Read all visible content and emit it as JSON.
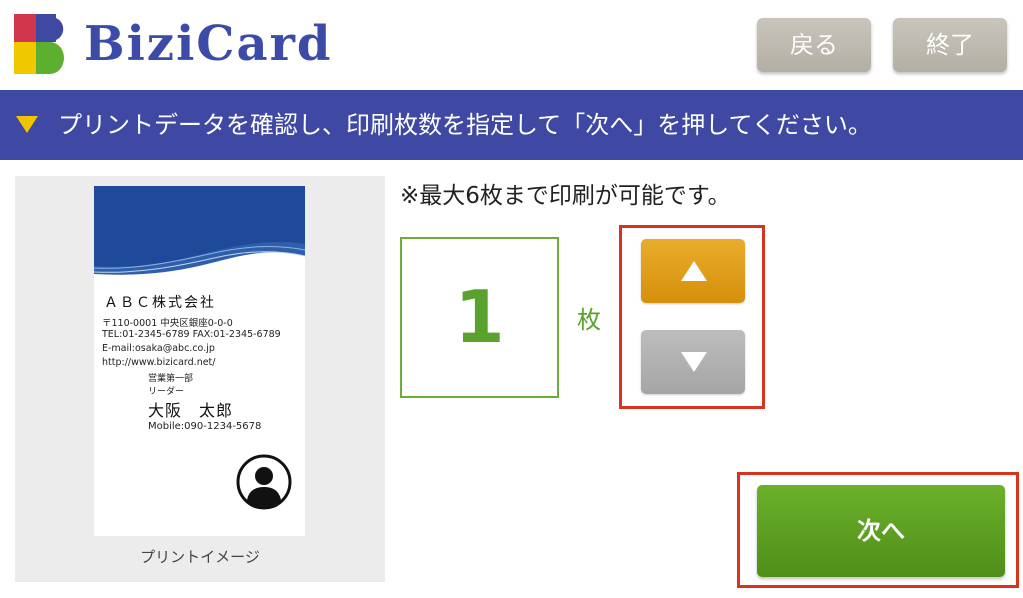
{
  "header": {
    "logo_text": "BiziCard",
    "back_label": "戻る",
    "exit_label": "終了"
  },
  "instruction": {
    "text": "プリントデータを確認し、印刷枚数を指定して「次へ」を押してください。"
  },
  "preview": {
    "caption": "プリントイメージ",
    "card": {
      "company": "ＡＢＣ株式会社",
      "address": "〒110-0001 中央区銀座0-0-0",
      "tel_fax": "TEL:01-2345-6789   FAX:01-2345-6789",
      "email": "E-mail:osaka@abc.co.jp",
      "url": "http://www.bizicard.net/",
      "department": "営業第一部",
      "title": "リーダー",
      "name": "大阪　太郎",
      "mobile": "Mobile:090-1234-5678"
    }
  },
  "print": {
    "note": "※最大6枚まで印刷が可能です。",
    "count": "1",
    "unit": "枚",
    "max": 6
  },
  "next_label": "次へ",
  "colors": {
    "bar": "#3f48a3",
    "logo_text": "#3c4aa8",
    "accent_green": "#5aa22e",
    "up_button": "#e09f1b",
    "down_button": "#b1b1b1",
    "highlight_border": "#d9331f",
    "header_button": "#bdb9af"
  }
}
